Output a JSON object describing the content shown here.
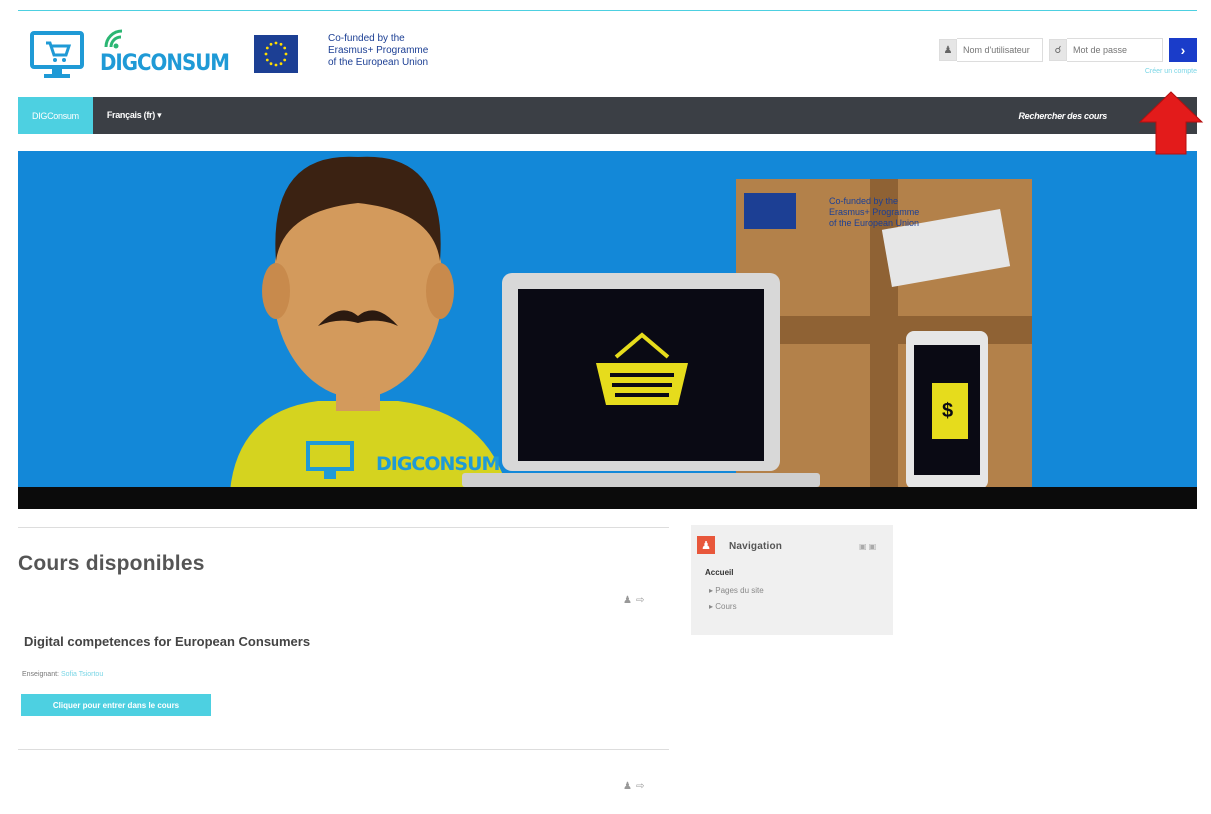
{
  "header": {
    "logo_text": "DIGCONSUM",
    "eu_text_line1": "Co-funded by the",
    "eu_text_line2": "Erasmus+ Programme",
    "eu_text_line3": "of the European Union",
    "username_placeholder": "Nom d'utilisateur",
    "password_placeholder": "Mot de passe",
    "login_button": "›",
    "create_account": "Créer un compte"
  },
  "navbar": {
    "brand": "DIGConsum",
    "language": "Français (fr) ▾",
    "search_courses": "Rechercher des cours"
  },
  "banner": {
    "box_text_line1": "Co-funded by the",
    "box_text_line2": "Erasmus+ Programme",
    "box_text_line3": "of the European Union",
    "shirt_logo_text": "DIGCONSUM",
    "price_tag": "$"
  },
  "main": {
    "section_title": "Cours disponibles",
    "course": {
      "name": "Digital competences for European Consumers",
      "teacher_label": "Enseignant:",
      "teacher_name": "Sofia Tsiortou",
      "enter_button": "Cliquer pour entrer dans le cours"
    }
  },
  "navigation_block": {
    "title": "Navigation",
    "home": "Accueil",
    "items": [
      "Pages du site",
      "Cours"
    ]
  },
  "colors": {
    "accent": "#4dd0e1",
    "navbar": "#3b3f45",
    "banner_bg": "#1388d8",
    "login_button": "#1a3cc9",
    "nav_icon": "#e8573b",
    "annotation_arrow": "#e31b1b"
  }
}
